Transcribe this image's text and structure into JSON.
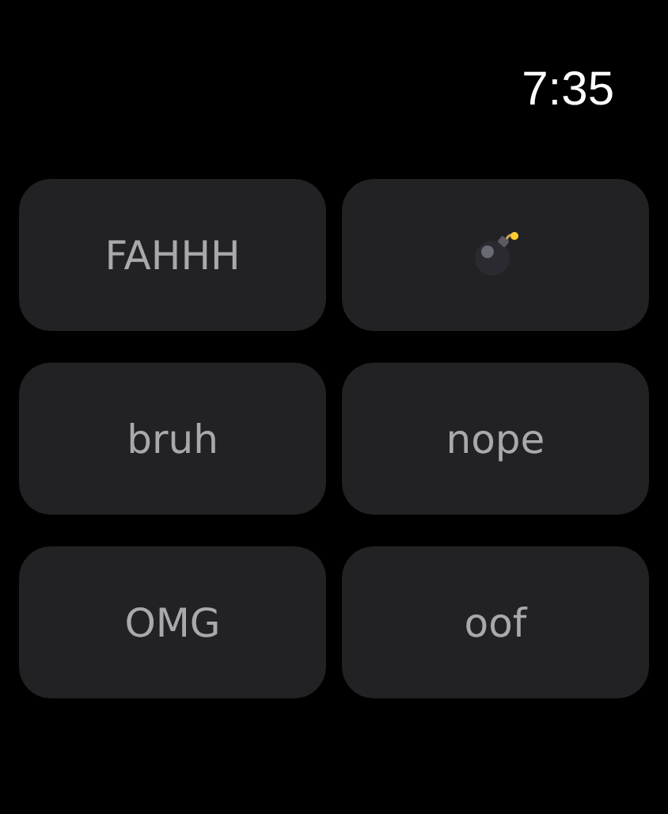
{
  "status_bar": {
    "time": "7:35"
  },
  "buttons": [
    {
      "kind": "text",
      "label": "FAHHH"
    },
    {
      "kind": "bomb"
    },
    {
      "kind": "text",
      "label": "bruh"
    },
    {
      "kind": "text",
      "label": "nope"
    },
    {
      "kind": "text",
      "label": "OMG"
    },
    {
      "kind": "text",
      "label": "oof"
    }
  ]
}
